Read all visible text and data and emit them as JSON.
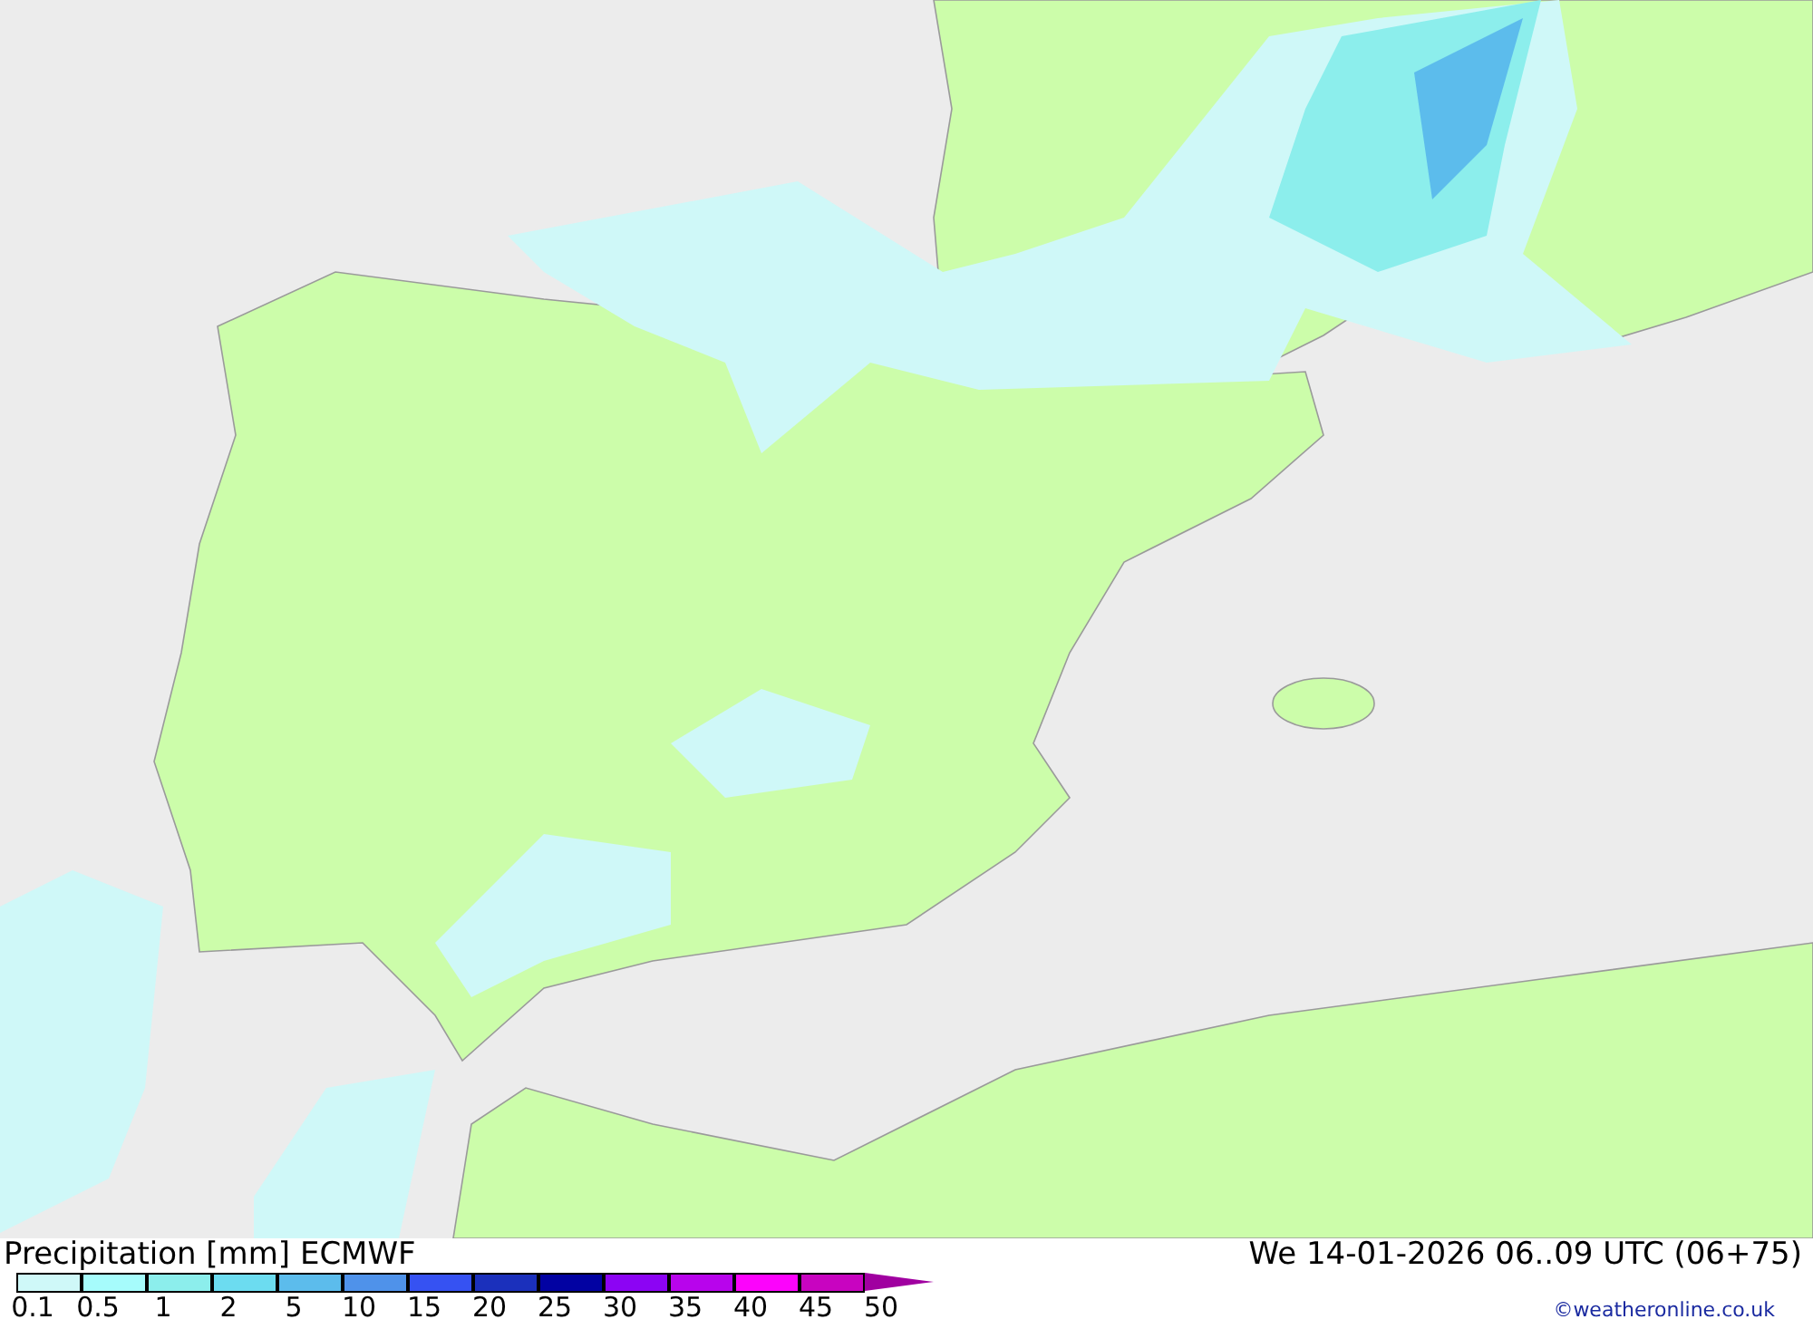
{
  "legend": {
    "title": "Precipitation [mm] ECMWF",
    "scale": [
      {
        "label": "0.1",
        "color": "#cff8f8"
      },
      {
        "label": "0.5",
        "color": "#a6fcfc"
      },
      {
        "label": "1",
        "color": "#8ceeec"
      },
      {
        "label": "2",
        "color": "#6cdcf0"
      },
      {
        "label": "5",
        "color": "#5cbcec"
      },
      {
        "label": "10",
        "color": "#4f92ea"
      },
      {
        "label": "15",
        "color": "#3652f2"
      },
      {
        "label": "20",
        "color": "#1b30bc"
      },
      {
        "label": "25",
        "color": "#0202a2"
      },
      {
        "label": "30",
        "color": "#8c04f4"
      },
      {
        "label": "35",
        "color": "#b804ec"
      },
      {
        "label": "40",
        "color": "#fc04fc"
      },
      {
        "label": "45",
        "color": "#c804c0"
      },
      {
        "label": "50",
        "color": "#a000a0"
      }
    ]
  },
  "valid_time": "We 14-01-2026 06..09 UTC (06+75)",
  "credit": "©weatheronline.co.uk"
}
